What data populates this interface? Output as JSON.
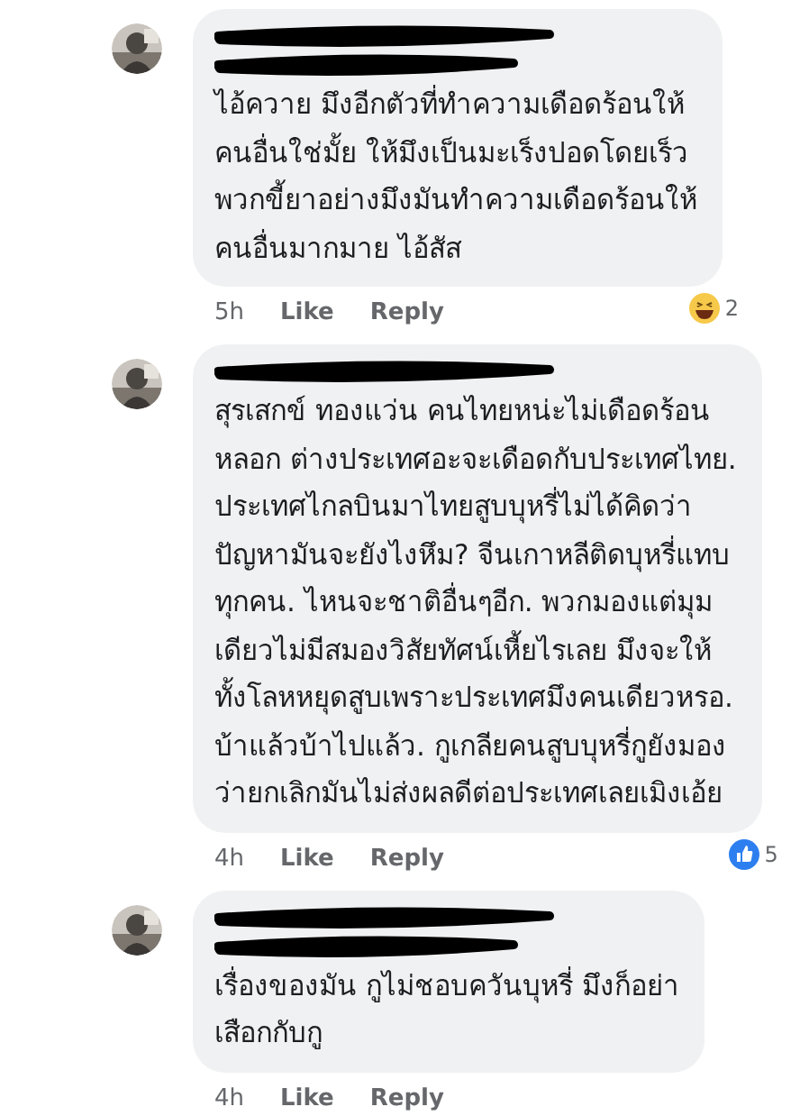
{
  "comments": [
    {
      "avatar": {
        "kind": "picture"
      },
      "redactions": [
        {
          "kind": "scribble"
        },
        {
          "kind": "scribble"
        }
      ],
      "lines": [
        "ไอ้ควาย มึงอีกตัวที่ทำความเดือดร้อนให้",
        "คนอื่นใช่มั้ย ให้มึงเป็นมะเร็งปอดโดยเร็ว",
        "พวกขี้ยาอย่างมึงมันทำความเดือดร้อนให้",
        "คนอื่นมากมาย ไอ้สัส"
      ],
      "time": "5h",
      "actions": [
        "Like",
        "Reply"
      ],
      "reaction": {
        "kind": "haha",
        "count": "2"
      }
    },
    {
      "avatar": {
        "kind": "picture"
      },
      "redactions": [
        {
          "kind": "scribble"
        }
      ],
      "lines": [
        "สุรเสกข์ ทองแว่น คนไทยหน่ะไม่เดือดร้อน",
        "หลอก ต่างประเทศอะจะเดือดกับประเทศไทย.",
        "ประเทศไกลบินมาไทยสูบบุหรี่ไม่ได้คิดว่า",
        "ปัญหามันจะยังไงหึม?  จีนเกาหลีติดบุหรี่แทบ",
        "ทุกคน. ไหนจะชาติอื่นๆอีก. พวกมองแต่มุม",
        "เดียวไม่มีสมองวิสัยทัศน์เหี้ยไรเลย มึงจะให้",
        "ทั้งโลหหยุดสูบเพราะประเทศมึงคนเดียวหรอ.",
        "บ้าแล้วบ้าไปแล้ว. กูเกลียคนสูบบุหรี่กูยังมอง",
        "ว่ายกเลิกมันไม่ส่งผลดีต่อประเทศเลยเมิงเอ้ย"
      ],
      "time": "4h",
      "actions": [
        "Like",
        "Reply"
      ],
      "reaction": {
        "kind": "like",
        "count": "5"
      }
    },
    {
      "avatar": {
        "kind": "picture"
      },
      "redactions": [
        {
          "kind": "scribble"
        },
        {
          "kind": "scribble"
        }
      ],
      "lines": [
        "เรื่องของมัน กูไม่ชอบควันบุหรี่ มึงก็อย่า",
        "เสือกกับกู"
      ],
      "time": "4h",
      "actions": [
        "Like",
        "Reply"
      ]
    }
  ]
}
